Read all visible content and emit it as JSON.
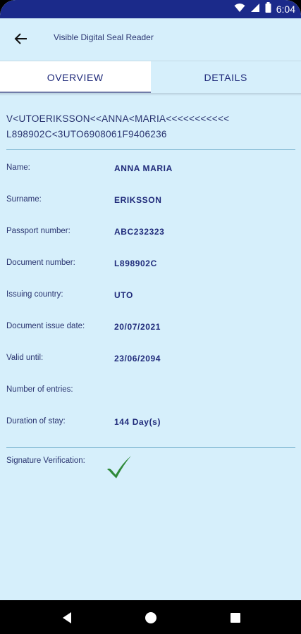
{
  "status_bar": {
    "time": "6:04",
    "icons": [
      "wifi-icon",
      "signal-icon",
      "battery-icon"
    ]
  },
  "app_bar": {
    "back_icon": "arrow-back-icon",
    "title": "Visible Digital Seal Reader"
  },
  "tabs": [
    {
      "label": "OVERVIEW",
      "active": true
    },
    {
      "label": "DETAILS",
      "active": false
    }
  ],
  "mrz": {
    "line1": "V<UTOERIKSSON<<ANNA<MARIA<<<<<<<<<<<",
    "line2": "L898902C<3UTO6908061F9406236"
  },
  "fields": [
    {
      "label": "Name:",
      "value": "ANNA MARIA"
    },
    {
      "label": "Surname:",
      "value": "ERIKSSON"
    },
    {
      "label": "Passport number:",
      "value": "ABC232323"
    },
    {
      "label": "Document number:",
      "value": "L898902C"
    },
    {
      "label": "Issuing country:",
      "value": "UTO"
    },
    {
      "label": "Document issue date:",
      "value": "20/07/2021"
    },
    {
      "label": "Valid until:",
      "value": "23/06/2094"
    },
    {
      "label": "Number of entries:",
      "value": ""
    },
    {
      "label": "Duration of stay:",
      "value": "144 Day(s)"
    }
  ],
  "signature": {
    "label": "Signature Verification:",
    "status_icon": "checkmark-icon"
  },
  "colors": {
    "status_bar": "#1b2a8a",
    "background": "#d6effb",
    "text": "#1f2a7a",
    "check": "#2f8a3a"
  }
}
